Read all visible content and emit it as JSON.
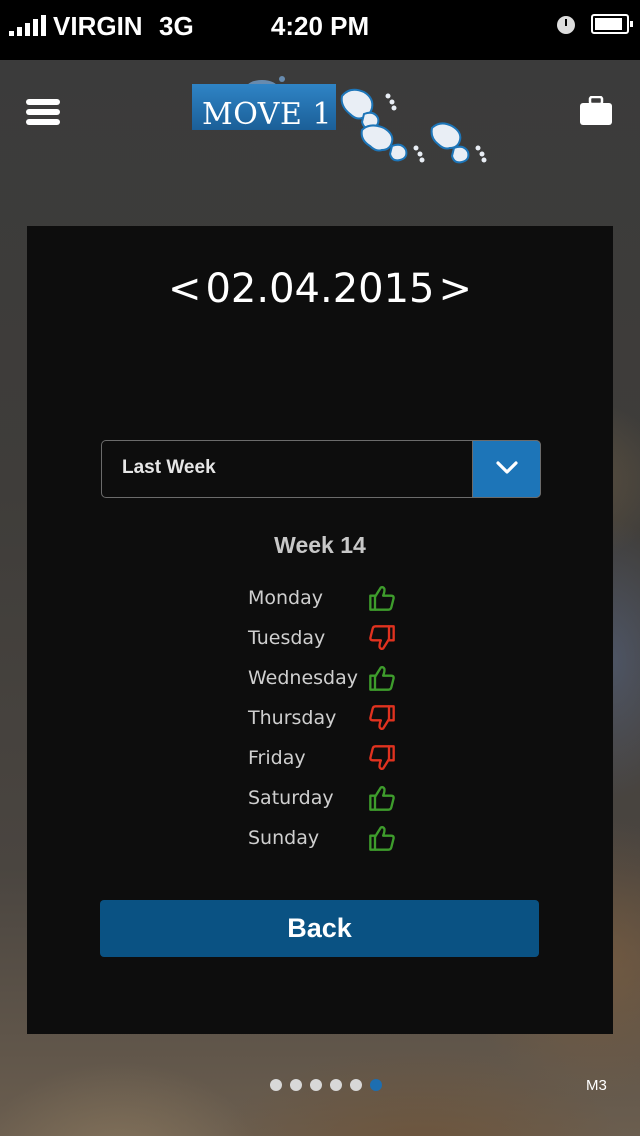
{
  "status_bar": {
    "carrier": "VIRGIN",
    "network": "3G",
    "time": "4:20 PM",
    "signal_bars": 5,
    "battery_level": 0.9
  },
  "header": {
    "logo_text": "MOVE 1",
    "menu_icon": "hamburger-menu-icon",
    "right_icon": "briefcase-icon",
    "brand_color": "#1d75b8"
  },
  "card": {
    "date_prev": "<",
    "date": "02.04.2015",
    "date_next": ">",
    "period_select": {
      "value": "Last Week",
      "icon": "chevron-down-icon"
    },
    "week_label": "Week 14",
    "days": [
      {
        "name": "Monday",
        "status": "up"
      },
      {
        "name": "Tuesday",
        "status": "down"
      },
      {
        "name": "Wednesday",
        "status": "up"
      },
      {
        "name": "Thursday",
        "status": "down"
      },
      {
        "name": "Friday",
        "status": "down"
      },
      {
        "name": "Saturday",
        "status": "up"
      },
      {
        "name": "Sunday",
        "status": "up"
      }
    ],
    "status_colors": {
      "up": "#3e9d2c",
      "down": "#e0321f"
    },
    "back_label": "Back"
  },
  "pagination": {
    "total": 6,
    "active_index": 5,
    "page_code": "M3"
  }
}
